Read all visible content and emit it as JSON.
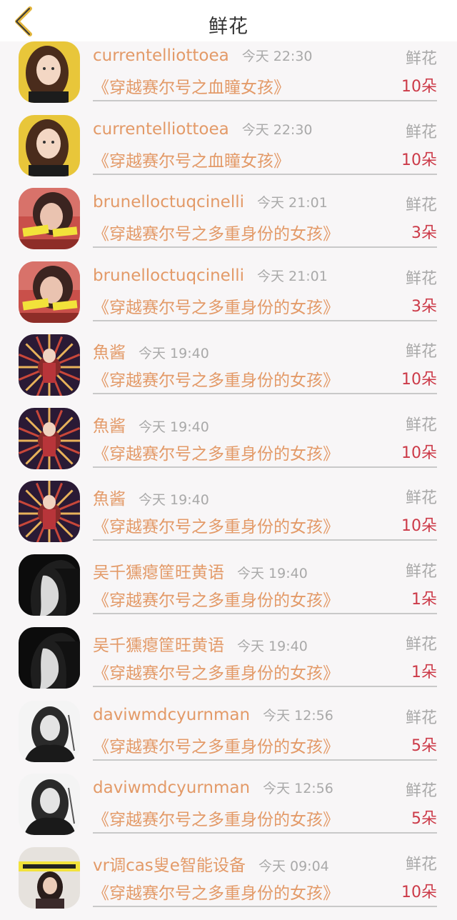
{
  "header": {
    "title": "鲜花",
    "back_icon": "chevron-left-icon"
  },
  "colors": {
    "accent": "#e39a68",
    "count": "#cc3a48",
    "meta": "#a9a9a9"
  },
  "items": [
    {
      "user": "currentelliottoea",
      "time": "今天 22:30",
      "kind": "鲜花",
      "book": "《穿越赛尔号之血瞳女孩》",
      "count": "10朵",
      "avatar": "yellow"
    },
    {
      "user": "currentelliottoea",
      "time": "今天 22:30",
      "kind": "鲜花",
      "book": "《穿越赛尔号之血瞳女孩》",
      "count": "10朵",
      "avatar": "yellow"
    },
    {
      "user": "brunelloctuqcinelli",
      "time": "今天 21:01",
      "kind": "鲜花",
      "book": "《穿越赛尔号之多重身份的女孩》",
      "count": "3朵",
      "avatar": "red"
    },
    {
      "user": "brunelloctuqcinelli",
      "time": "今天 21:01",
      "kind": "鲜花",
      "book": "《穿越赛尔号之多重身份的女孩》",
      "count": "3朵",
      "avatar": "red"
    },
    {
      "user": "魚酱",
      "time": "今天 19:40",
      "kind": "鲜花",
      "book": "《穿越赛尔号之多重身份的女孩》",
      "count": "10朵",
      "avatar": "anime"
    },
    {
      "user": "魚酱",
      "time": "今天 19:40",
      "kind": "鲜花",
      "book": "《穿越赛尔号之多重身份的女孩》",
      "count": "10朵",
      "avatar": "anime"
    },
    {
      "user": "魚酱",
      "time": "今天 19:40",
      "kind": "鲜花",
      "book": "《穿越赛尔号之多重身份的女孩》",
      "count": "10朵",
      "avatar": "anime"
    },
    {
      "user": "吴千獯瘪筐旺黄语",
      "time": "今天 19:40",
      "kind": "鲜花",
      "book": "《穿越赛尔号之多重身份的女孩》",
      "count": "1朵",
      "avatar": "dark"
    },
    {
      "user": "吴千獯瘪筐旺黄语",
      "time": "今天 19:40",
      "kind": "鲜花",
      "book": "《穿越赛尔号之多重身份的女孩》",
      "count": "1朵",
      "avatar": "dark"
    },
    {
      "user": "daviwmdcyurnman",
      "time": "今天 12:56",
      "kind": "鲜花",
      "book": "《穿越赛尔号之多重身份的女孩》",
      "count": "5朵",
      "avatar": "sketch"
    },
    {
      "user": "daviwmdcyurnman",
      "time": "今天 12:56",
      "kind": "鲜花",
      "book": "《穿越赛尔号之多重身份的女孩》",
      "count": "5朵",
      "avatar": "sketch"
    },
    {
      "user": "vr调cas叟e智能设备",
      "time": "今天 09:04",
      "kind": "鲜花",
      "book": "《穿越赛尔号之多重身份的女孩》",
      "count": "10朵",
      "avatar": "banner"
    }
  ]
}
